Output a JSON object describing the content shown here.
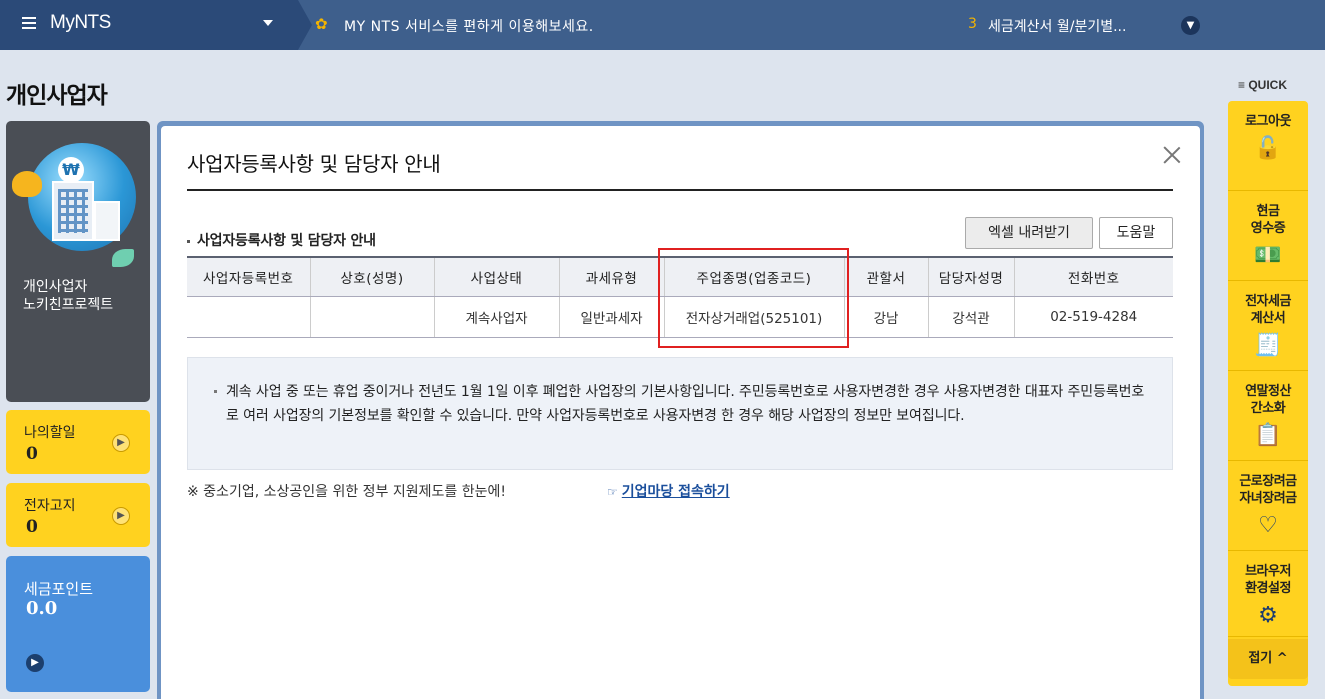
{
  "topbar": {
    "brand": "MyNTS",
    "notice_text": "MY NTS 서비스를 편하게 이용해보세요.",
    "notice_num": "3",
    "notice_title": "세금계산서 월/분기별..."
  },
  "page": {
    "title": "개인사업자"
  },
  "profile": {
    "type": "개인사업자",
    "name": "노키친프로젝트"
  },
  "cards": {
    "todo_label": "나의할일",
    "todo_value": "0",
    "notice_label": "전자고지",
    "notice_value": "0",
    "points_label": "세금포인트",
    "points_value": "0.0"
  },
  "modal": {
    "title": "사업자등록사항 및 담당자 안내",
    "section_title": "사업자등록사항 및 담당자 안내",
    "excel_button": "엑셀 내려받기",
    "help_button": "도움말",
    "table": {
      "headers": [
        "사업자등록번호",
        "상호(성명)",
        "사업상태",
        "과세유형",
        "주업종명(업종코드)",
        "관할서",
        "담당자성명",
        "전화번호"
      ],
      "row": [
        "",
        "",
        "계속사업자",
        "일반과세자",
        "전자상거래업(525101)",
        "강남",
        "강석관",
        "02-519-4284"
      ]
    },
    "note": "계속 사업 중 또는 휴업 중이거나 전년도 1월 1일 이후 폐업한 사업장의 기본사항입니다. 주민등록번호로 사용자변경한 경우 사용자변경한 대표자 주민등록번호로 여러 사업장의 기본정보를 확인할 수 있습니다. 만약 사업자등록번호로 사용자변경 한 경우 해당 사업장의 정보만 보여집니다.",
    "footer_note": "※ 중소기업, 소상공인을 위한 정부 지원제도를 한눈에!",
    "footer_link": "기업마당 접속하기"
  },
  "quick": {
    "label": "QUICK",
    "items": [
      "로그아웃",
      "현금\n영수증",
      "전자세금\n계산서",
      "연말정산\n간소화",
      "근로장려금\n자녀장려금",
      "브라우저\n환경설정"
    ],
    "fold": "접기"
  }
}
